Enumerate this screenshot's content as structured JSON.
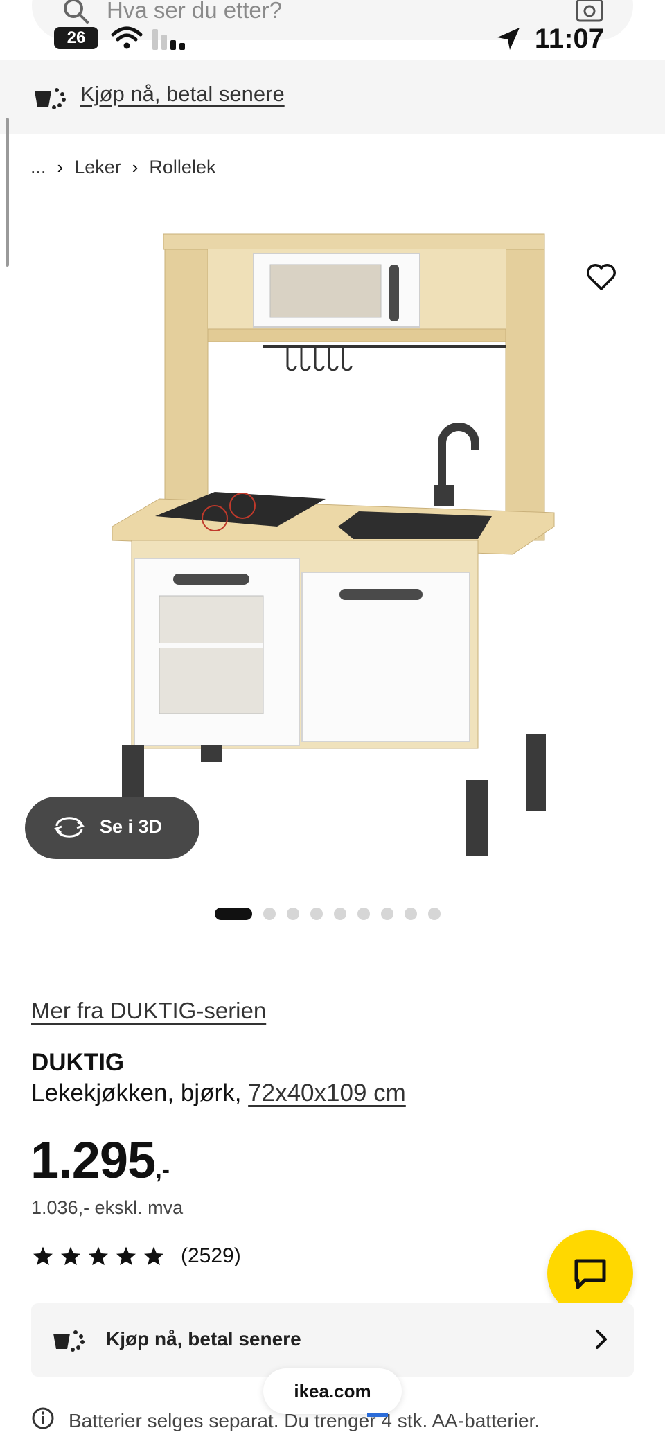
{
  "search": {
    "placeholder": "Hva ser du etter?"
  },
  "status_bar": {
    "battery": "26",
    "time": "11:07"
  },
  "top_banner": {
    "label": "Kjøp nå, betal senere"
  },
  "breadcrumb": {
    "ellipsis": "...",
    "items": [
      "Leker",
      "Rollelek"
    ]
  },
  "gallery": {
    "see_3d_label": "Se i 3D",
    "total_images": 9,
    "active_index": 0
  },
  "product": {
    "series_link": "Mer fra DUKTIG-serien",
    "name": "DUKTIG",
    "description": "Lekekjøkken, bjørk, ",
    "dimensions": "72x40x109 cm",
    "price_main": "1.295",
    "price_suffix": ",-",
    "price_ex_vat": "1.036,- ekskl. mva",
    "rating_stars": 5,
    "rating_count": "(2529)"
  },
  "buy_card": {
    "label": "Kjøp nå, betal senere"
  },
  "battery_note": {
    "text": "Batterier selges separat. Du trenger 4 stk. AA-batterier."
  },
  "browser": {
    "url": "ikea.com"
  },
  "colors": {
    "chat_button": "#ffd800",
    "see3d_bg": "#484848",
    "banner_bg": "#f5f5f5"
  }
}
